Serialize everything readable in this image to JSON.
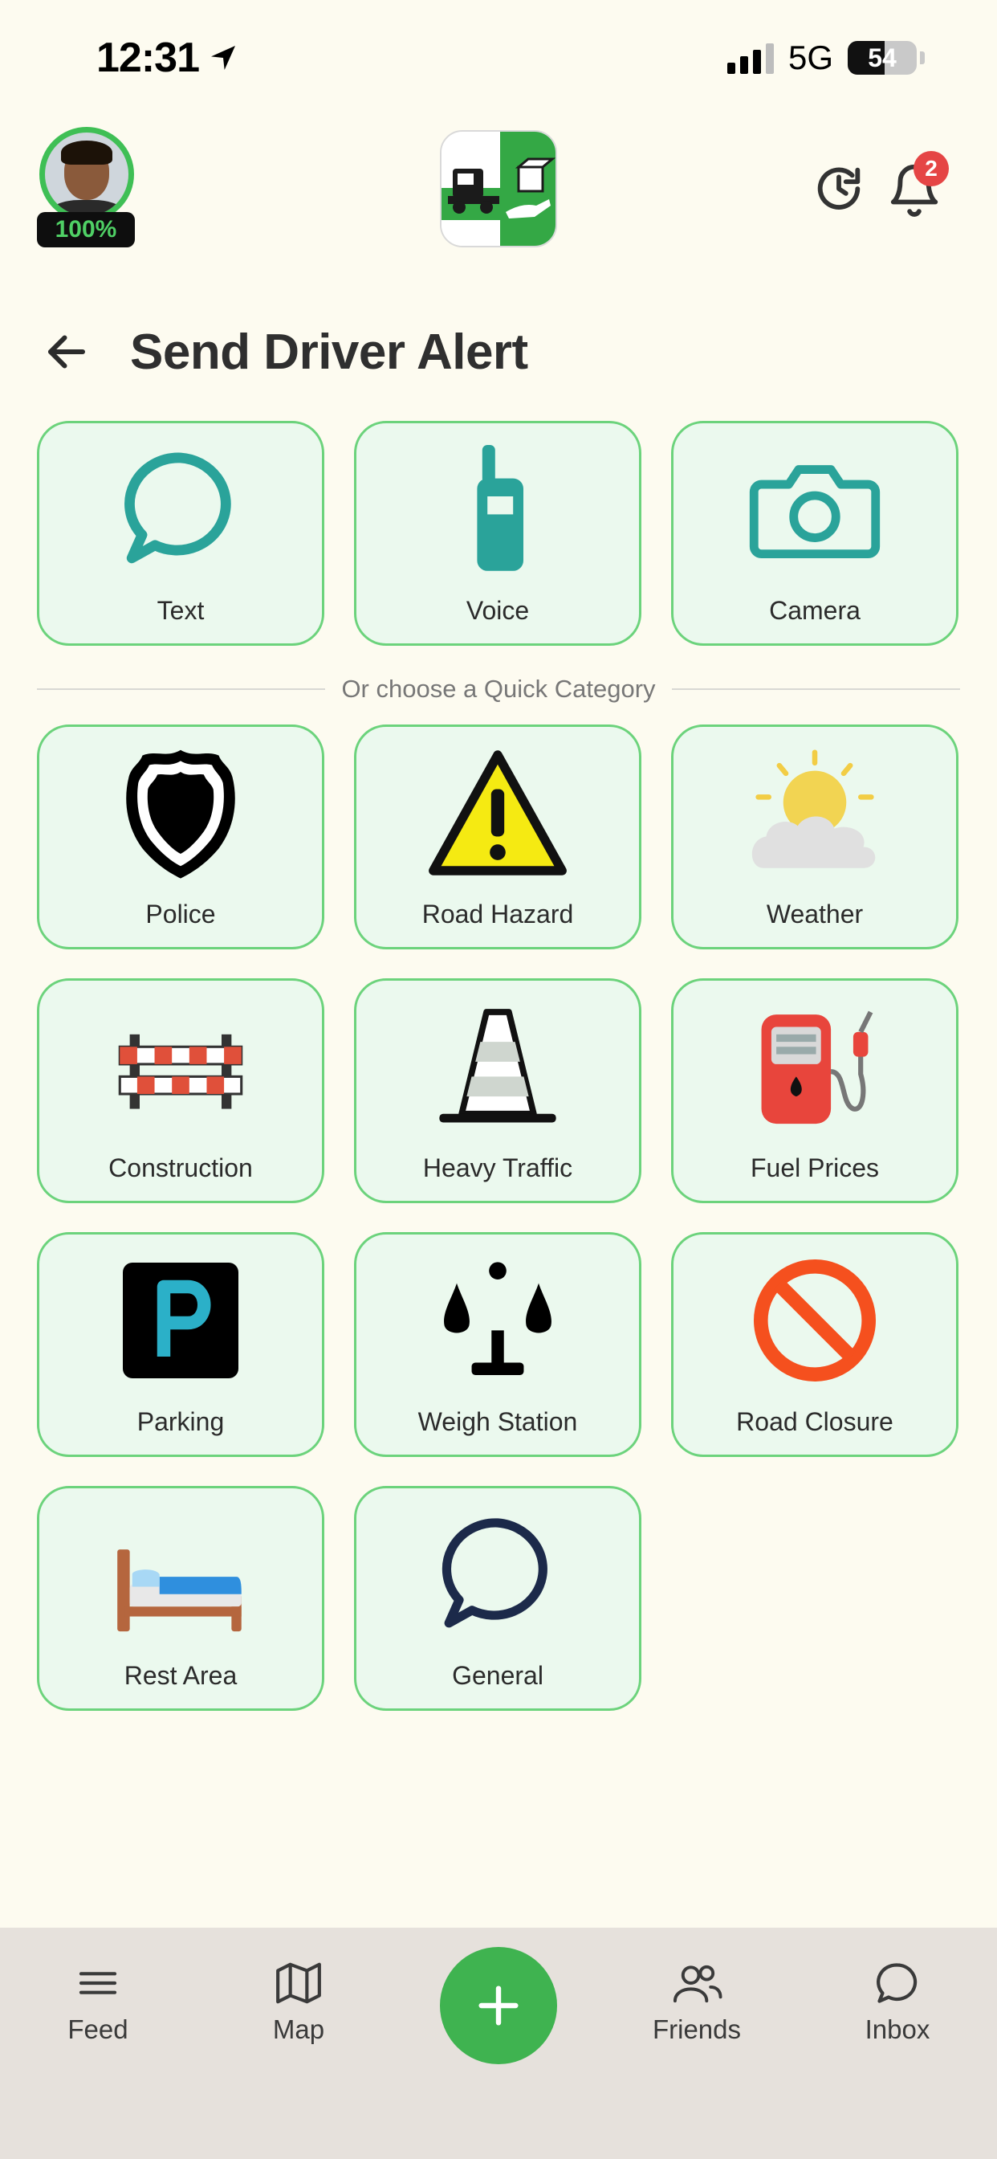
{
  "status_bar": {
    "time": "12:31",
    "network": "5G",
    "battery_percent": "54",
    "battery_level": 0.54
  },
  "header": {
    "avatar_progress": "100%",
    "notification_count": "2",
    "icons": [
      "avatar",
      "app-logo-icon",
      "history-icon",
      "bell-icon"
    ]
  },
  "page": {
    "title": "Send Driver Alert"
  },
  "input_methods": [
    {
      "label": "Text",
      "icon": "chat-bubble-icon"
    },
    {
      "label": "Voice",
      "icon": "walkie-talkie-icon"
    },
    {
      "label": "Camera",
      "icon": "camera-icon"
    }
  ],
  "divider_text": "Or choose a Quick Category",
  "categories": [
    {
      "label": "Police",
      "icon": "police-shield-icon"
    },
    {
      "label": "Road Hazard",
      "icon": "warning-sign-icon"
    },
    {
      "label": "Weather",
      "icon": "sun-cloud-icon"
    },
    {
      "label": "Construction",
      "icon": "barrier-icon"
    },
    {
      "label": "Heavy Traffic",
      "icon": "traffic-cone-icon"
    },
    {
      "label": "Fuel Prices",
      "icon": "fuel-pump-icon"
    },
    {
      "label": "Parking",
      "icon": "parking-icon"
    },
    {
      "label": "Weigh Station",
      "icon": "scale-icon"
    },
    {
      "label": "Road Closure",
      "icon": "no-entry-icon"
    },
    {
      "label": "Rest Area",
      "icon": "bed-icon"
    },
    {
      "label": "General",
      "icon": "speech-bubble-icon"
    }
  ],
  "bottom_nav": {
    "feed": "Feed",
    "map": "Map",
    "friends": "Friends",
    "inbox": "Inbox"
  },
  "colors": {
    "background": "#fdfbf0",
    "tile_bg": "#ebf9ee",
    "tile_border": "#6cd37c",
    "accent_green": "#3fb350",
    "teal": "#2aa39a",
    "badge_red": "#e54545"
  }
}
